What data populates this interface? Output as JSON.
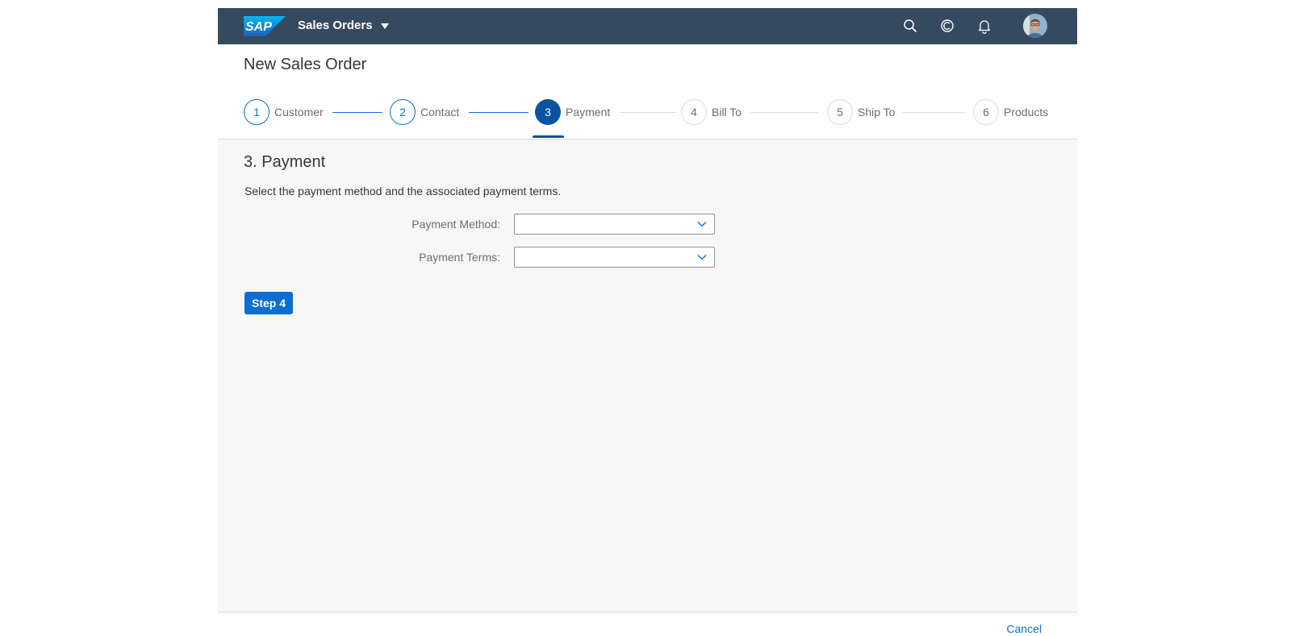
{
  "shell": {
    "logo_text": "SAP",
    "app_title": "Sales Orders",
    "brand_color": "#354a5f",
    "icons": [
      "search-icon",
      "copilot-icon",
      "bell-icon",
      "user-avatar"
    ]
  },
  "page": {
    "title": "New Sales Order"
  },
  "wizard": {
    "steps": [
      {
        "number": "1",
        "label": "Customer",
        "state": "done"
      },
      {
        "number": "2",
        "label": "Contact",
        "state": "done"
      },
      {
        "number": "3",
        "label": "Payment",
        "state": "current"
      },
      {
        "number": "4",
        "label": "Bill To",
        "state": "future"
      },
      {
        "number": "5",
        "label": "Ship To",
        "state": "future"
      },
      {
        "number": "6",
        "label": "Products",
        "state": "future"
      }
    ]
  },
  "section": {
    "title": "3. Payment",
    "description": "Select the payment method and the associated payment terms.",
    "payment_method_label": "Payment Method:",
    "payment_method_value": "",
    "payment_terms_label": "Payment Terms:",
    "payment_terms_value": "",
    "next_button": "Step 4"
  },
  "footer": {
    "cancel": "Cancel"
  },
  "colors": {
    "accent": "#0a6ed1",
    "current_step": "#0854a0",
    "content_bg": "#f7f7f7"
  }
}
